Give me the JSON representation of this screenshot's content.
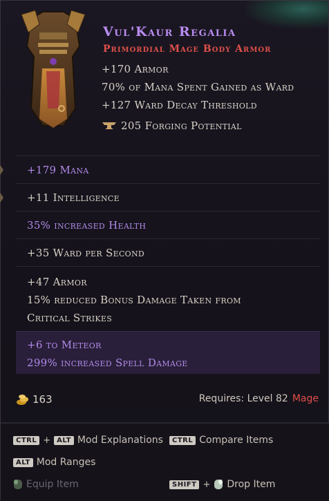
{
  "item": {
    "name": "Vul'Kaur Regalia",
    "type": "Primordial Mage Body Armor",
    "implicits": [
      "+170 Armor",
      "70% of Mana Spent Gained as Ward",
      "+127 Ward Decay Threshold"
    ],
    "forging_potential": "205 Forging Potential"
  },
  "affixes": [
    {
      "lines": [
        "+179 Mana"
      ],
      "color": "#b08ae8"
    },
    {
      "lines": [
        "+11 Intelligence"
      ],
      "color": "#d9d3c8"
    },
    {
      "lines": [
        "35% increased Health"
      ],
      "color": "#b08ae8"
    },
    {
      "lines": [
        "+35 Ward per Second"
      ],
      "color": "#d9d3c8"
    },
    {
      "lines": [
        "+47 Armor",
        "15% reduced Bonus Damage Taken from",
        "Critical Strikes"
      ],
      "color": "#d9d3c8"
    },
    {
      "lines": [
        "+6 to Meteor",
        "299% increased Spell Damage"
      ],
      "color": "#b08ae8"
    }
  ],
  "footer": {
    "gold": "163",
    "requires_label": "Requires: Level 82",
    "class": "Mage"
  },
  "hints": {
    "ctrl": "CTRL",
    "alt": "ALT",
    "shift": "SHIFT",
    "plus": "+",
    "mod_explanations": "Mod Explanations",
    "compare_items": "Compare Items",
    "mod_ranges": "Mod Ranges",
    "equip_item": "Equip Item",
    "drop_item": "Drop Item"
  },
  "colors": {
    "name": "#b98cf0",
    "type": "#e0504a",
    "purple_affix": "#b08ae8",
    "white_affix": "#d9d3c8"
  }
}
